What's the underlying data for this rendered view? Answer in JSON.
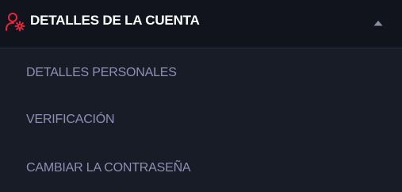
{
  "section": {
    "title": "DETALLES DE LA CUENTA",
    "icon": "user-settings-icon",
    "icon_color": "#e8253a",
    "toggle_icon": "chevron-up-icon",
    "expanded": true
  },
  "menu": {
    "items": [
      {
        "label": "DETALLES PERSONALES"
      },
      {
        "label": "VERIFICACIÓN"
      },
      {
        "label": "CAMBIAR LA CONTRASEÑA"
      }
    ]
  },
  "colors": {
    "header_bg": "#11141d",
    "panel_bg": "#181c27",
    "title_text": "#ffffff",
    "item_text": "#8f8fb6",
    "caret": "#8a8fa3"
  }
}
